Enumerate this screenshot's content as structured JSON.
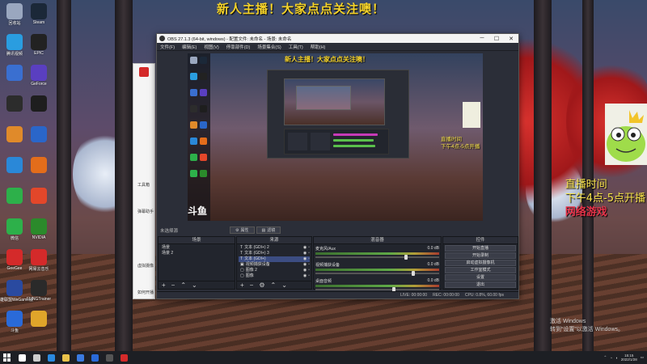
{
  "desktop": {
    "banner": "新人主播！大家点点关注噢！",
    "live_time_title": "直播时间",
    "live_time_value": "下午4点-5点开播",
    "live_time_extra": "网络游戏",
    "activate_line1": "激活 Windows",
    "activate_line2": "转到“设置”以激活 Windows。",
    "icons": [
      {
        "label": "回收站",
        "color": "#9aa7bf"
      },
      {
        "label": "Steam",
        "color": "#1b2838"
      },
      {
        "label": "腾讯视频",
        "color": "#2a9de0"
      },
      {
        "label": "EPIC",
        "color": "#222222"
      },
      {
        "label": "1",
        "color": "#3a6fd0"
      },
      {
        "label": "GeForce",
        "color": "#5a3fc0"
      },
      {
        "label": "1",
        "color": "#2c2c2c"
      },
      {
        "label": "1",
        "color": "#1e1e1e"
      },
      {
        "label": "1",
        "color": "#e08a2a"
      },
      {
        "label": "1",
        "color": "#2a66c9"
      },
      {
        "label": "1",
        "color": "#2a88d8"
      },
      {
        "label": "1",
        "color": "#e36d1b"
      },
      {
        "label": "1",
        "color": "#2db04a"
      },
      {
        "label": "1",
        "color": "#e3472a"
      },
      {
        "label": "微信",
        "color": "#2db04a"
      },
      {
        "label": "NVIDIA",
        "color": "#2b8a2b"
      },
      {
        "label": "GeeGee",
        "color": "#d42a2a"
      },
      {
        "label": "网易云音乐",
        "color": "#d42a2a"
      },
      {
        "label": "英雄联盟WeGame版",
        "color": "#2a4aa0"
      },
      {
        "label": "FLiNGTrainer",
        "color": "#2a2a2a"
      },
      {
        "label": "斗鱼",
        "color": "#2a6ad8"
      },
      {
        "label": "1",
        "color": "#e0a52a"
      }
    ],
    "white_window": {
      "texts": [
        "工具箱",
        "弹幕助手",
        "",
        "虚拟摄像",
        "",
        "如何开播"
      ]
    }
  },
  "obs": {
    "title": "OBS 27.1.3 (64-bit, windows) - 配置文件: 未命名 - 场景: 未命名",
    "menu": [
      "文件(F)",
      "编辑(E)",
      "视图(V)",
      "停靠部件(D)",
      "场景集合(S)",
      "工具(T)",
      "帮助(H)"
    ],
    "preview": {
      "banner": "新人主播！大家点点关注噢！",
      "time_title": "直播时间",
      "time_value": "下午4点-5点开播",
      "logo": "斗鱼"
    },
    "source_label": "未选择源",
    "prop_button": "属性",
    "filter_button": "滤镜",
    "docks": {
      "scenes": {
        "title": "场景",
        "items": [
          "场景",
          "场景 2"
        ]
      },
      "sources": {
        "title": "来源",
        "items": [
          {
            "name": "文本 (GDI+) 2",
            "icon": "T"
          },
          {
            "name": "文本 (GDI+) 3",
            "icon": "T"
          },
          {
            "name": "文本 (GDI+)",
            "icon": "T",
            "selected": true
          },
          {
            "name": "视频捕获设备",
            "icon": "▣"
          },
          {
            "name": "图像 2",
            "icon": "▢"
          },
          {
            "name": "图像",
            "icon": "▢"
          }
        ]
      },
      "mixer": {
        "title": "混音器",
        "tracks": [
          {
            "name": "麦克风/Aux",
            "db": "0.0 dB",
            "level": 0.72
          },
          {
            "name": "视频捕获设备",
            "db": "0.0 dB",
            "level": 0.78
          },
          {
            "name": "桌面音频",
            "db": "0.0 dB",
            "level": 0.62
          }
        ]
      },
      "controls": {
        "title": "控件",
        "buttons": [
          "开始直播",
          "开始录制",
          "启动虚拟摄像机",
          "工作室模式",
          "设置",
          "退出"
        ]
      }
    },
    "status": {
      "live": "LIVE: 00:00:00",
      "rec": "REC: 00:00:00",
      "cpu": "CPU: 0.8%, 60.00 fps"
    }
  },
  "taskbar": {
    "items": [
      {
        "name": "search",
        "color": "#ffffff"
      },
      {
        "name": "taskview",
        "color": "#cccccc"
      },
      {
        "name": "edge",
        "color": "#2a8ae0"
      },
      {
        "name": "explorer",
        "color": "#e8c24a"
      },
      {
        "name": "store",
        "color": "#3a7ae0"
      },
      {
        "name": "douyu",
        "color": "#2a6ad8"
      },
      {
        "name": "obs",
        "color": "#555555"
      },
      {
        "name": "netease",
        "color": "#d42a2a"
      }
    ],
    "time": "15:15",
    "date": "2022/1/28"
  }
}
